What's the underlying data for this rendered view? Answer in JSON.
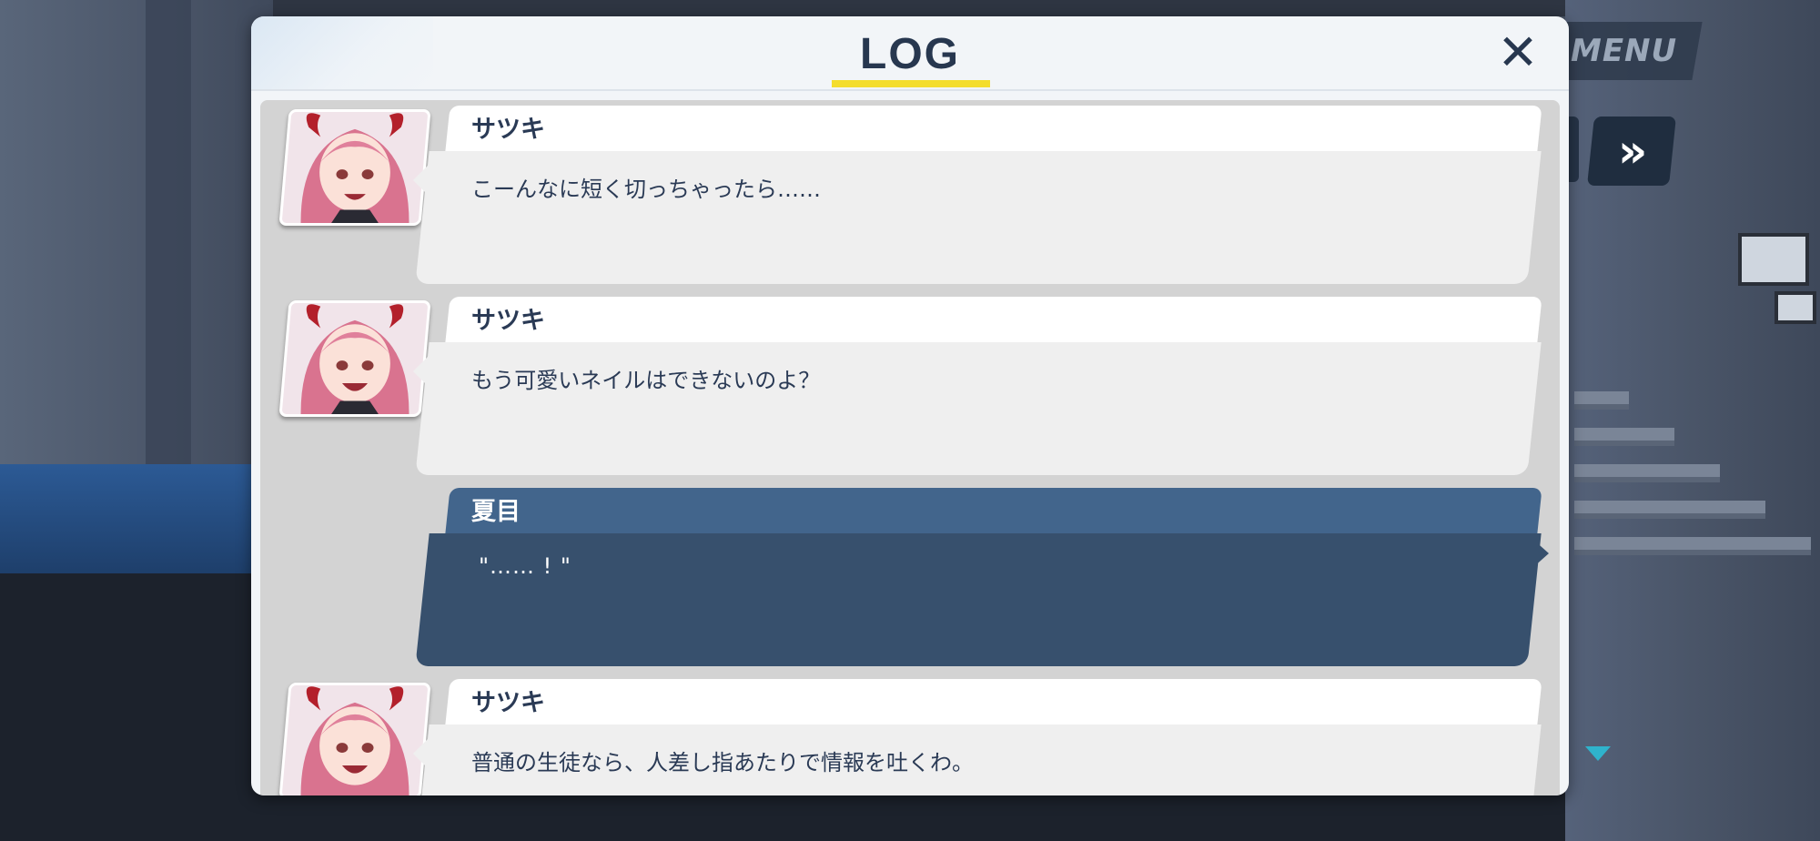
{
  "hud": {
    "menu_label": "MENU",
    "skip_label": "»"
  },
  "log_panel": {
    "title": "LOG",
    "close_label": "✕",
    "entries": [
      {
        "speaker": "サツキ",
        "text": "こーんなに短く切っちゃったら……",
        "type": "npc"
      },
      {
        "speaker": "サツキ",
        "text": "もう可愛いネイルはできないのよ？",
        "type": "npc"
      },
      {
        "speaker": "夏目",
        "text": "\"…… ! \"",
        "type": "player"
      },
      {
        "speaker": "サツキ",
        "text": "普通の生徒なら、人差し指あたりで情報を吐くわ。",
        "type": "npc"
      }
    ]
  },
  "colors": {
    "title_accent": "#f4dd2c",
    "player_bubble": "#37506d",
    "player_name_bar": "#42658c",
    "npc_bubble": "#efefef",
    "text_dark": "#2a3a55"
  }
}
